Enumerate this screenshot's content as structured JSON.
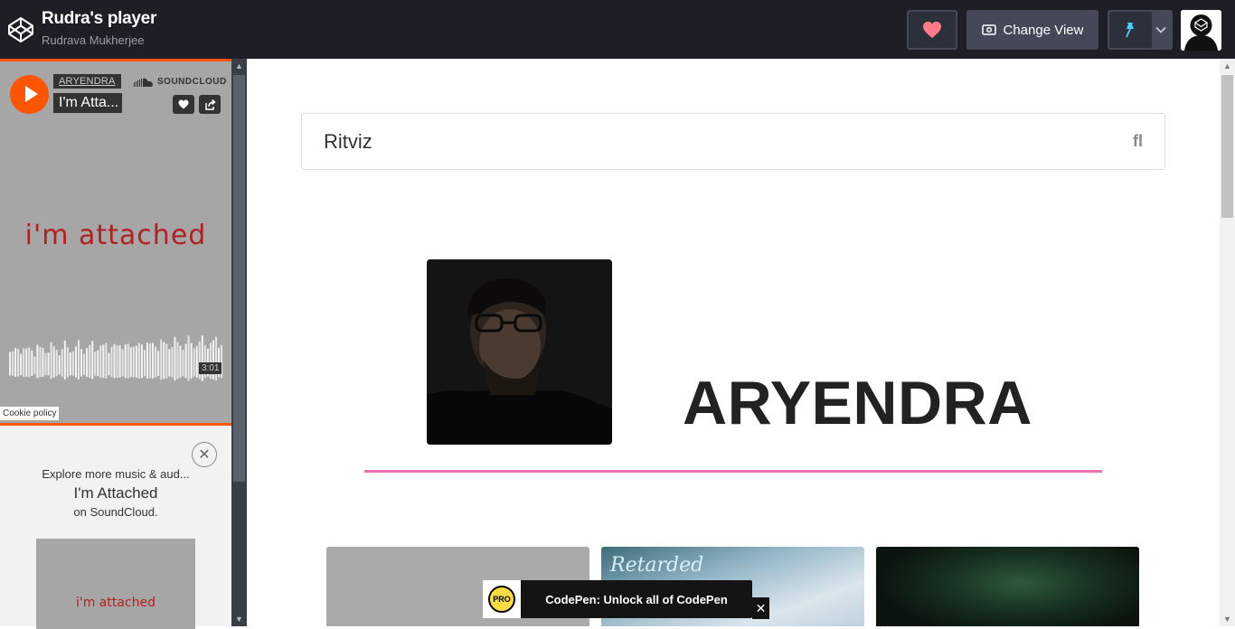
{
  "header": {
    "title": "Rudra's player",
    "author": "Rudrava Mukherjee",
    "change_view_label": "Change View",
    "heart_color": "#ff7a8a",
    "pin_color": "#47cfff"
  },
  "soundcloud": {
    "artist": "ARYENDRA",
    "track": "I'm Atta...",
    "brand": "SOUNDCLOUD",
    "artwork_text": "i'm attached",
    "duration": "3:01",
    "cookie_label": "Cookie policy",
    "accent": "#ff5500"
  },
  "promo": {
    "line1": "Explore more music & aud...",
    "line2": "I'm Attached",
    "line3": "on SoundCloud.",
    "artwork_text": "i'm attached"
  },
  "main": {
    "search_value": "Ritviz",
    "search_icon_glyph": "fl",
    "artist_name": "ARYENDRA",
    "divider_color": "#ee6fb3",
    "card2_text": "Retarded"
  },
  "toast": {
    "badge": "PRO",
    "text": "CodePen: Unlock all of CodePen",
    "close": "✕"
  }
}
